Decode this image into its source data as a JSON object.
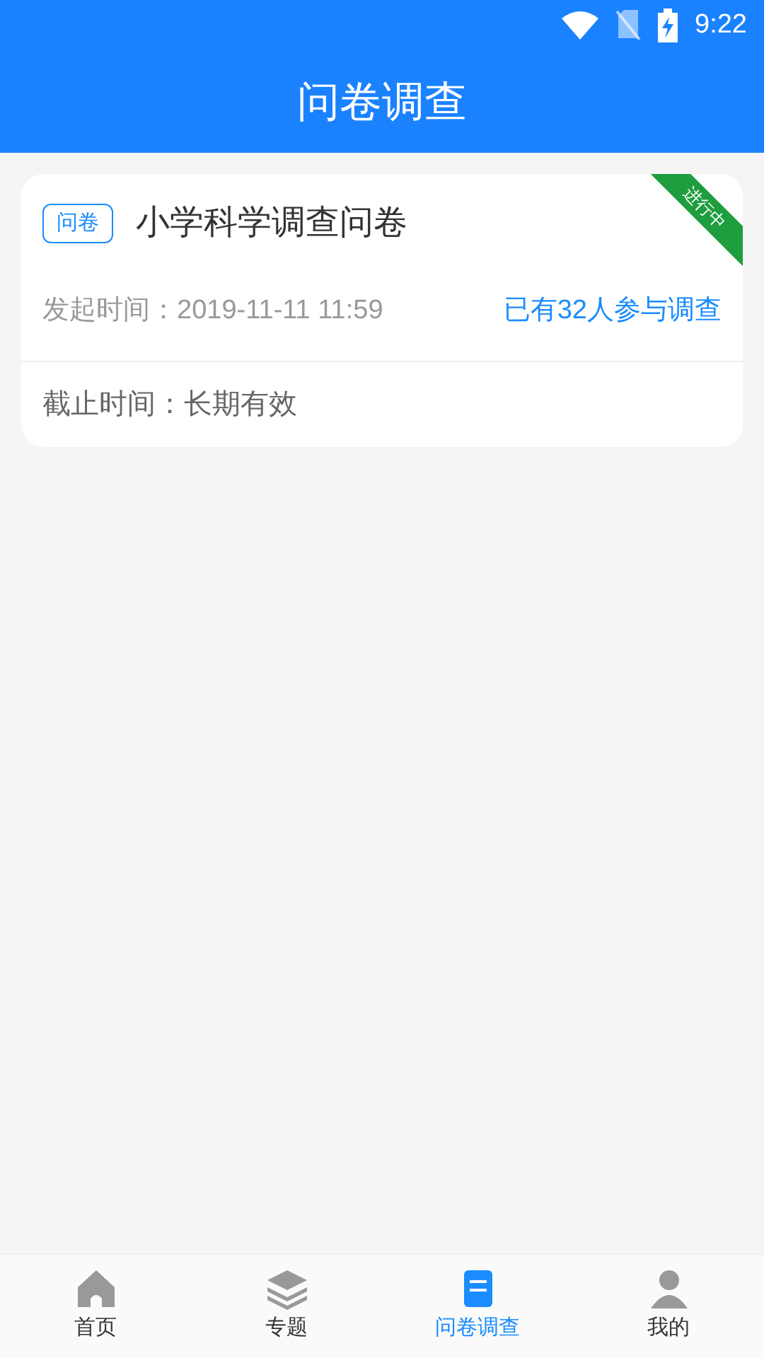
{
  "status_bar": {
    "time": "9:22"
  },
  "header": {
    "title": "问卷调查"
  },
  "surveys": [
    {
      "tag": "问卷",
      "title": "小学科学调查问卷",
      "ribbon": "进行中",
      "start_label": "发起时间：",
      "start_time": "2019-11-11 11:59",
      "participants": "已有32人参与调查",
      "deadline_label": "截止时间：",
      "deadline": "长期有效"
    }
  ],
  "tab_bar": [
    {
      "label": "首页",
      "kind": "home",
      "selected": false
    },
    {
      "label": "专题",
      "kind": "layers",
      "selected": false
    },
    {
      "label": "问卷调查",
      "kind": "survey",
      "selected": true
    },
    {
      "label": "我的",
      "kind": "person",
      "selected": false
    }
  ]
}
